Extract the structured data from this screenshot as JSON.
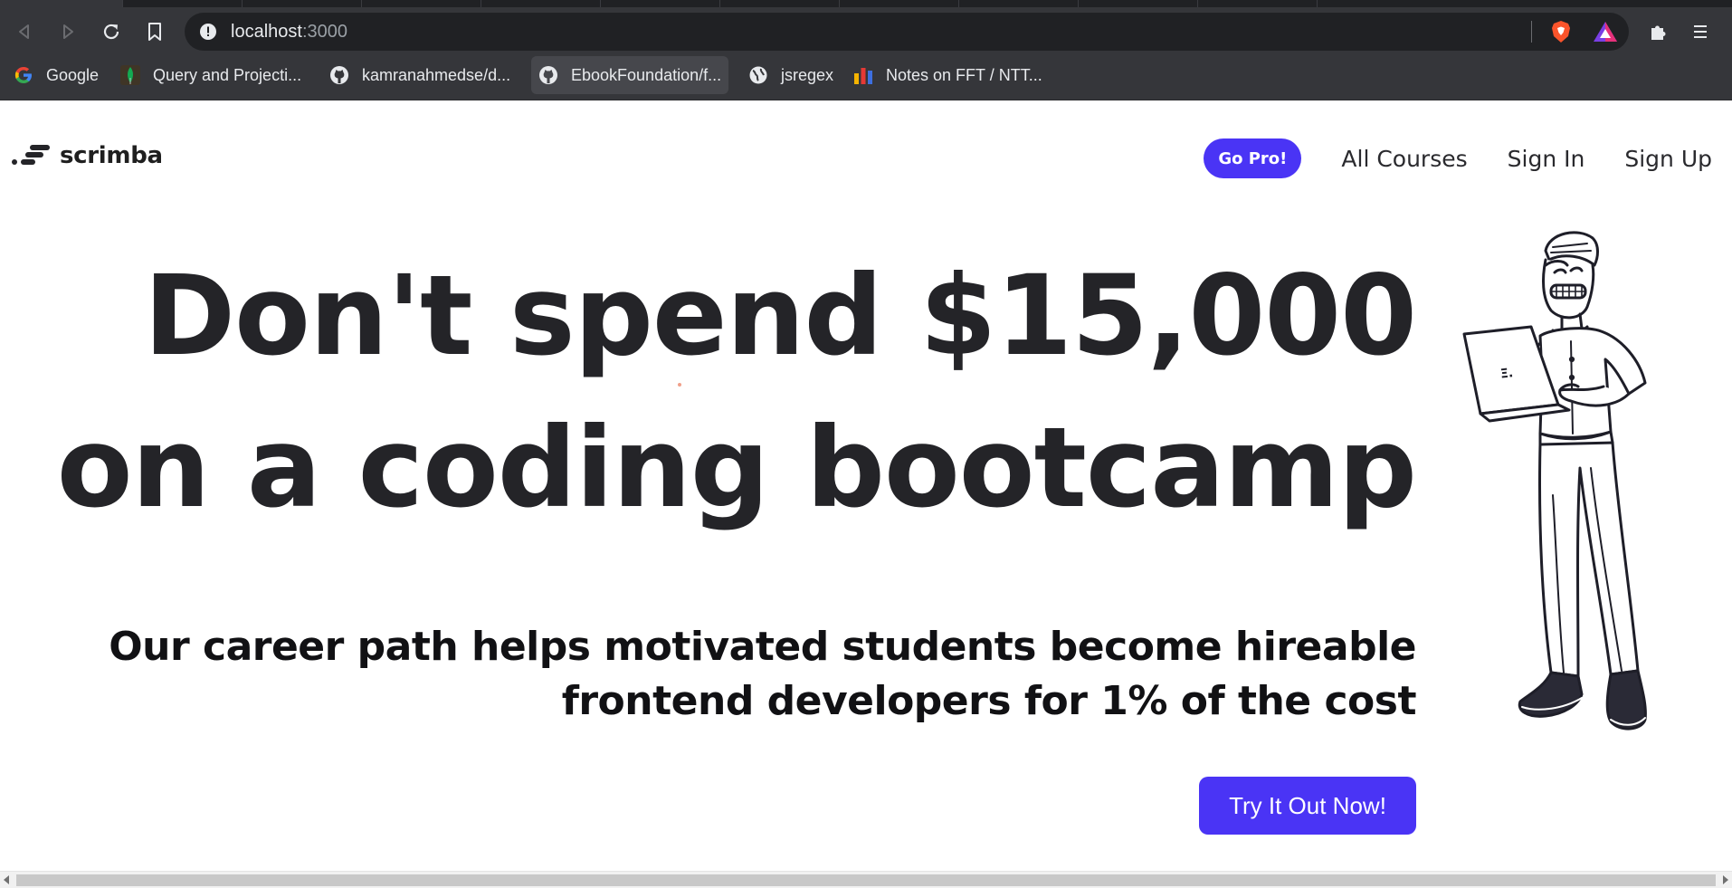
{
  "browser": {
    "url_host": "localhost",
    "url_port": ":3000",
    "bookmarks": [
      {
        "label": "Google",
        "icon": "google-icon"
      },
      {
        "label": "Query and Projecti...",
        "icon": "mongodb-leaf-icon"
      },
      {
        "label": "kamranahmedse/d...",
        "icon": "github-icon"
      },
      {
        "label": "EbookFoundation/f...",
        "icon": "github-icon"
      },
      {
        "label": "jsregex",
        "icon": "globe-icon"
      },
      {
        "label": "Notes on FFT / NTT...",
        "icon": "bar-chart-icon"
      }
    ]
  },
  "site": {
    "logo_text": "scrimba",
    "nav": {
      "pro": "Go Pro!",
      "courses": "All Courses",
      "signin": "Sign In",
      "signup": "Sign Up"
    },
    "hero": {
      "line1": "Don't spend $15,000",
      "line2": "on a coding bootcamp",
      "sub_line1": "Our career path helps motivated students become hireable",
      "sub_line2": "frontend developers for 1% of the cost",
      "cta": "Try It Out Now!"
    },
    "laptop_logo": "Ξ."
  },
  "colors": {
    "accent": "#4a34f5",
    "chrome_dark": "#35363a",
    "text_dark": "#242428"
  }
}
